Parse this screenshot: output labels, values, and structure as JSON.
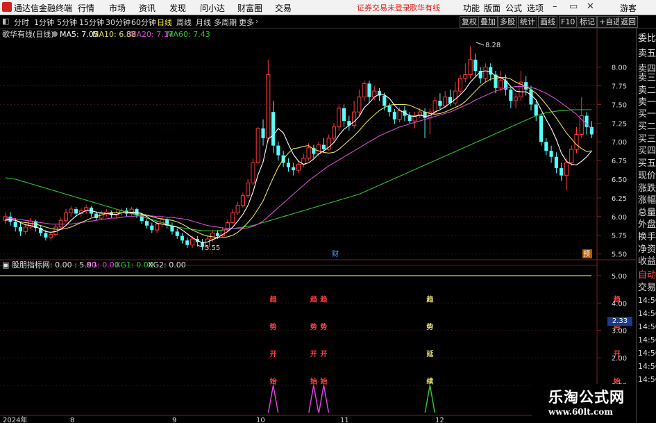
{
  "app": {
    "name": "通达信金融终端"
  },
  "menu": [
    "行情",
    "市场",
    "资讯",
    "发现",
    "问小达",
    "财富圈",
    "交易"
  ],
  "notice": {
    "text1": "证券交易未登录",
    "text2": "歌华有线"
  },
  "top_controls": [
    "功能",
    "版面",
    "公式",
    "选项"
  ],
  "user": "游客",
  "periods": [
    "分时",
    "1分钟",
    "5分钟",
    "15分钟",
    "30分钟",
    "60分钟",
    "日线",
    "周线",
    "月线",
    "多周期",
    "更多"
  ],
  "active_period": "日线",
  "tool_buttons": [
    "复权",
    "叠加",
    "多股",
    "统计",
    "画线",
    "F10",
    "标记",
    "+自选",
    "返回"
  ],
  "main_chart": {
    "stock_title": "歌华有线(日线)",
    "ma": [
      {
        "label": "MA5: 7.05",
        "color": "#ffffff"
      },
      {
        "label": "MA10: 6.88",
        "color": "#e8e060"
      },
      {
        "label": "MA20: 7.17",
        "color": "#d24fd2"
      },
      {
        "label": "MA60: 7.43",
        "color": "#2ec72e"
      }
    ],
    "price_axis": [
      "8.00",
      "7.75",
      "7.50",
      "7.25",
      "7.00",
      "6.75",
      "6.50",
      "6.25",
      "6.00",
      "5.75",
      "5.50"
    ],
    "high_mark": "8.28",
    "low_mark": "5.55",
    "event_marks": [
      "财",
      "预"
    ]
  },
  "indicator": {
    "title": "股朋指标网",
    "values_text": ": 0.00 : 5.00",
    "xg": "XG: 0.00",
    "xg1": "XG1: 0.00",
    "xg2": "XG2: 0.00",
    "axis": [
      "5.00",
      "4.00",
      "3.00",
      "2.00",
      "1.00"
    ],
    "signals": [
      {
        "chars": [
          "趋",
          "势",
          "开",
          "始"
        ],
        "color": "#ff4040"
      },
      {
        "chars": [
          "趋",
          "势",
          "开",
          "始"
        ],
        "color": "#ff4040"
      },
      {
        "chars": [
          "趋",
          "势",
          "开",
          "始"
        ],
        "color": "#ff4040"
      },
      {
        "chars": [
          "趋",
          "势",
          "延",
          "续"
        ],
        "color": "#e8e070"
      },
      {
        "chars": [
          "趋",
          "势",
          "开",
          "始"
        ],
        "color": "#ff4040"
      }
    ]
  },
  "date_axis": [
    "2024年",
    "8",
    "9",
    "10",
    "11",
    "12"
  ],
  "right_panel": {
    "labels": [
      "委比",
      "卖五",
      "卖四",
      "卖三",
      "卖二",
      "卖一",
      "买一",
      "买二",
      "买三",
      "买四",
      "买五",
      "现价",
      "涨跌",
      "涨幅",
      "总量",
      "外盘",
      "换手",
      "净资",
      "收益",
      "自动",
      "交易"
    ],
    "value": "2.33",
    "times": [
      "14:56",
      "14:56",
      "14:56",
      "14:56",
      "14:56",
      "14:56",
      "14:56"
    ]
  },
  "watermark": {
    "title": "乐淘公式网",
    "url": "www.60lt.com"
  },
  "chart_data": {
    "type": "candlestick",
    "series": [
      {
        "name": "MA5: 7.05",
        "color": "#ffffff"
      },
      {
        "name": "MA10: 6.88",
        "color": "#e8e060"
      },
      {
        "name": "MA20: 7.17",
        "color": "#d24fd2"
      },
      {
        "name": "MA60: 7.43",
        "color": "#2ec72e"
      }
    ],
    "candles": [
      [
        5.95,
        6.0,
        6.05,
        5.9
      ],
      [
        6.0,
        5.93,
        6.06,
        5.88
      ],
      [
        5.93,
        5.86,
        5.98,
        5.8
      ],
      [
        5.86,
        5.8,
        5.92,
        5.74
      ],
      [
        5.8,
        5.86,
        5.9,
        5.76
      ],
      [
        5.86,
        5.94,
        5.98,
        5.83
      ],
      [
        5.94,
        5.85,
        5.96,
        5.8
      ],
      [
        5.85,
        5.78,
        5.88,
        5.74
      ],
      [
        5.78,
        5.72,
        5.82,
        5.68
      ],
      [
        5.72,
        5.76,
        5.8,
        5.68
      ],
      [
        5.76,
        5.86,
        5.9,
        5.74
      ],
      [
        5.86,
        5.95,
        5.99,
        5.84
      ],
      [
        5.95,
        6.05,
        6.1,
        5.92
      ],
      [
        6.05,
        6.1,
        6.14,
        6.0
      ],
      [
        6.1,
        6.04,
        6.13,
        6.0
      ],
      [
        6.04,
        6.08,
        6.11,
        6.0
      ],
      [
        6.08,
        6.12,
        6.16,
        6.04
      ],
      [
        6.12,
        6.04,
        6.14,
        6.0
      ],
      [
        6.04,
        5.98,
        6.07,
        5.95
      ],
      [
        5.98,
        6.04,
        6.08,
        5.95
      ],
      [
        6.04,
        6.06,
        6.1,
        6.0
      ],
      [
        6.06,
        6.02,
        6.08,
        5.98
      ],
      [
        6.02,
        6.05,
        6.09,
        5.98
      ],
      [
        6.05,
        6.08,
        6.11,
        6.01
      ],
      [
        6.08,
        6.04,
        6.12,
        6.0
      ],
      [
        6.04,
        6.1,
        6.13,
        6.01
      ],
      [
        6.1,
        6.02,
        6.12,
        5.98
      ],
      [
        6.02,
        5.94,
        6.05,
        5.9
      ],
      [
        5.94,
        5.88,
        5.97,
        5.84
      ],
      [
        5.88,
        5.82,
        5.92,
        5.78
      ],
      [
        5.82,
        5.9,
        5.94,
        5.78
      ],
      [
        5.9,
        5.96,
        6.0,
        5.86
      ],
      [
        5.96,
        5.88,
        5.98,
        5.84
      ],
      [
        5.88,
        5.8,
        5.92,
        5.76
      ],
      [
        5.8,
        5.74,
        5.84,
        5.7
      ],
      [
        5.74,
        5.68,
        5.78,
        5.64
      ],
      [
        5.68,
        5.62,
        5.72,
        5.58
      ],
      [
        5.62,
        5.7,
        5.74,
        5.58
      ],
      [
        5.7,
        5.66,
        5.74,
        5.6
      ],
      [
        5.66,
        5.6,
        5.7,
        5.55
      ],
      [
        5.6,
        5.7,
        5.74,
        5.58
      ],
      [
        5.7,
        5.78,
        5.82,
        5.66
      ],
      [
        5.78,
        5.74,
        5.82,
        5.7
      ],
      [
        5.74,
        5.82,
        5.86,
        5.72
      ],
      [
        5.82,
        5.92,
        5.96,
        5.8
      ],
      [
        5.92,
        6.05,
        6.1,
        5.9
      ],
      [
        6.05,
        6.15,
        6.2,
        6.02
      ],
      [
        6.15,
        6.28,
        6.32,
        6.12
      ],
      [
        6.28,
        6.45,
        6.5,
        6.25
      ],
      [
        6.45,
        6.72,
        6.78,
        6.42
      ],
      [
        6.72,
        7.18,
        7.2,
        6.7
      ],
      [
        7.18,
        7.05,
        7.3,
        6.95
      ],
      [
        7.05,
        7.9,
        8.1,
        7.0
      ],
      [
        7.4,
        6.95,
        7.55,
        6.85
      ],
      [
        6.95,
        6.82,
        7.0,
        6.75
      ],
      [
        6.82,
        6.72,
        6.88,
        6.66
      ],
      [
        6.72,
        6.66,
        6.78,
        6.6
      ],
      [
        6.66,
        6.62,
        6.72,
        6.55
      ],
      [
        6.62,
        6.7,
        6.75,
        6.58
      ],
      [
        6.7,
        6.78,
        6.84,
        6.66
      ],
      [
        6.78,
        6.92,
        6.98,
        6.75
      ],
      [
        6.92,
        6.84,
        6.96,
        6.78
      ],
      [
        6.84,
        6.96,
        7.0,
        6.8
      ],
      [
        6.96,
        6.9,
        7.05,
        6.85
      ],
      [
        6.9,
        7.05,
        7.1,
        6.88
      ],
      [
        7.05,
        7.2,
        7.25,
        7.0
      ],
      [
        7.2,
        7.45,
        7.5,
        7.15
      ],
      [
        7.45,
        7.28,
        7.5,
        7.2
      ],
      [
        7.28,
        7.22,
        7.35,
        7.15
      ],
      [
        7.22,
        7.4,
        7.55,
        7.18
      ],
      [
        7.4,
        7.6,
        7.7,
        7.36
      ],
      [
        7.6,
        7.78,
        7.82,
        7.55
      ],
      [
        7.78,
        7.6,
        7.82,
        7.52
      ],
      [
        7.6,
        7.68,
        7.75,
        7.56
      ],
      [
        7.68,
        7.62,
        7.72,
        7.55
      ],
      [
        7.62,
        7.48,
        7.66,
        7.42
      ],
      [
        7.48,
        7.4,
        7.52,
        7.34
      ],
      [
        7.4,
        7.3,
        7.44,
        7.24
      ],
      [
        7.3,
        7.42,
        7.46,
        7.26
      ],
      [
        7.42,
        7.35,
        7.48,
        7.28
      ],
      [
        7.35,
        7.28,
        7.4,
        7.24
      ],
      [
        7.28,
        7.35,
        7.4,
        7.18
      ],
      [
        7.35,
        7.4,
        7.45,
        7.32
      ],
      [
        7.4,
        7.32,
        7.45,
        7.05
      ],
      [
        7.32,
        7.4,
        7.45,
        7.1
      ],
      [
        7.4,
        7.55,
        7.6,
        7.36
      ],
      [
        7.55,
        7.48,
        7.65,
        7.44
      ],
      [
        7.48,
        7.6,
        7.68,
        7.45
      ],
      [
        7.6,
        7.52,
        7.7,
        7.48
      ],
      [
        7.52,
        7.68,
        7.8,
        7.48
      ],
      [
        7.68,
        7.85,
        7.9,
        7.64
      ],
      [
        7.85,
        7.9,
        8.05,
        7.8
      ],
      [
        7.9,
        8.1,
        8.28,
        7.85
      ],
      [
        8.1,
        7.95,
        8.18,
        7.88
      ],
      [
        7.95,
        7.85,
        8.0,
        7.78
      ],
      [
        7.85,
        8.0,
        8.05,
        7.8
      ],
      [
        8.0,
        7.9,
        8.05,
        7.82
      ],
      [
        7.9,
        7.72,
        7.95,
        7.65
      ],
      [
        7.72,
        7.82,
        7.95,
        7.68
      ],
      [
        7.82,
        7.7,
        7.9,
        7.62
      ],
      [
        7.7,
        7.55,
        7.75,
        7.45
      ],
      [
        7.55,
        7.6,
        7.65,
        7.45
      ],
      [
        7.6,
        7.8,
        7.95,
        7.55
      ],
      [
        7.8,
        7.7,
        7.88,
        7.62
      ],
      [
        7.7,
        7.5,
        7.75,
        7.42
      ],
      [
        7.5,
        7.35,
        7.55,
        7.28
      ],
      [
        7.35,
        7.0,
        7.38,
        6.95
      ],
      [
        7.0,
        6.88,
        7.05,
        6.82
      ],
      [
        6.88,
        6.8,
        6.95,
        6.72
      ],
      [
        6.8,
        6.65,
        6.86,
        6.58
      ],
      [
        6.65,
        6.55,
        6.72,
        6.48
      ],
      [
        6.55,
        6.72,
        6.78,
        6.35
      ],
      [
        6.72,
        6.9,
        6.95,
        6.68
      ],
      [
        6.9,
        7.1,
        7.2,
        6.85
      ],
      [
        7.1,
        7.35,
        7.6,
        7.05
      ],
      [
        7.35,
        7.2,
        7.4,
        7.1
      ],
      [
        7.2,
        7.1,
        7.28,
        7.05
      ]
    ],
    "ma5": [
      5.95,
      5.96,
      5.95,
      5.92,
      5.89,
      5.88,
      5.86,
      5.84,
      5.8,
      5.79,
      5.8,
      5.83,
      5.88,
      5.95,
      6.01,
      6.05,
      6.08,
      6.08,
      6.06,
      6.05,
      6.04,
      6.03,
      6.03,
      6.05,
      6.05,
      6.06,
      6.06,
      6.04,
      6.0,
      5.95,
      5.91,
      5.9,
      5.89,
      5.87,
      5.86,
      5.82,
      5.77,
      5.72,
      5.68,
      5.65,
      5.66,
      5.69,
      5.72,
      5.76,
      5.8,
      5.86,
      5.94,
      6.03,
      6.15,
      6.33,
      6.56,
      6.73,
      7.04,
      7.09,
      7.18,
      7.12,
      6.97,
      6.83,
      6.74,
      6.7,
      6.72,
      6.77,
      6.84,
      6.88,
      6.93,
      6.99,
      7.09,
      7.17,
      7.22,
      7.27,
      7.34,
      7.46,
      7.52,
      7.6,
      7.64,
      7.63,
      7.58,
      7.49,
      7.42,
      7.39,
      7.35,
      7.34,
      7.36,
      7.34,
      7.35,
      7.4,
      7.43,
      7.47,
      7.52,
      7.57,
      7.63,
      7.7,
      7.8,
      7.87,
      7.94,
      7.95,
      7.94,
      7.88,
      7.86,
      7.82,
      7.74,
      7.68,
      7.67,
      7.67,
      7.63,
      7.56,
      7.43,
      7.3,
      7.18,
      7.03,
      6.85,
      6.74,
      6.7,
      6.69,
      6.74,
      6.8,
      6.88
    ],
    "ma10": [
      5.96,
      5.96,
      5.95,
      5.93,
      5.92,
      5.91,
      5.9,
      5.88,
      5.86,
      5.84,
      5.83,
      5.83,
      5.84,
      5.86,
      5.89,
      5.92,
      5.95,
      5.98,
      6.0,
      6.02,
      6.04,
      6.05,
      6.05,
      6.05,
      6.05,
      6.05,
      6.04,
      6.03,
      6.02,
      6.0,
      5.98,
      5.97,
      5.96,
      5.95,
      5.93,
      5.9,
      5.86,
      5.82,
      5.79,
      5.76,
      5.74,
      5.73,
      5.72,
      5.72,
      5.73,
      5.75,
      5.79,
      5.85,
      5.92,
      6.0,
      6.1,
      6.21,
      6.37,
      6.52,
      6.66,
      6.77,
      6.85,
      6.91,
      6.92,
      6.94,
      6.95,
      6.9,
      6.88,
      6.86,
      6.85,
      6.86,
      6.9,
      6.96,
      7.02,
      7.08,
      7.15,
      7.23,
      7.3,
      7.36,
      7.42,
      7.46,
      7.49,
      7.5,
      7.5,
      7.5,
      7.49,
      7.46,
      7.43,
      7.4,
      7.38,
      7.37,
      7.38,
      7.4,
      7.43,
      7.46,
      7.49,
      7.54,
      7.61,
      7.68,
      7.75,
      7.8,
      7.84,
      7.85,
      7.86,
      7.86,
      7.84,
      7.8,
      7.77,
      7.74,
      7.7,
      7.65,
      7.58,
      7.5,
      7.41,
      7.32,
      7.22,
      7.12,
      7.04,
      6.96,
      6.91,
      6.87,
      6.88
    ],
    "ma20": [
      5.98,
      5.98,
      5.97,
      5.96,
      5.95,
      5.94,
      5.93,
      5.92,
      5.91,
      5.9,
      5.9,
      5.9,
      5.9,
      5.9,
      5.91,
      5.92,
      5.93,
      5.94,
      5.95,
      5.96,
      5.97,
      5.98,
      5.98,
      5.99,
      6.0,
      6.0,
      6.01,
      6.01,
      6.01,
      6.01,
      6.0,
      6.0,
      5.99,
      5.99,
      5.98,
      5.97,
      5.96,
      5.94,
      5.92,
      5.9,
      5.88,
      5.87,
      5.86,
      5.85,
      5.84,
      5.84,
      5.84,
      5.84,
      5.85,
      5.87,
      5.9,
      5.94,
      6.0,
      6.06,
      6.12,
      6.18,
      6.24,
      6.3,
      6.36,
      6.42,
      6.48,
      6.53,
      6.58,
      6.63,
      6.68,
      6.72,
      6.76,
      6.8,
      6.84,
      6.88,
      6.92,
      6.96,
      7.0,
      7.04,
      7.08,
      7.11,
      7.14,
      7.17,
      7.2,
      7.22,
      7.24,
      7.26,
      7.28,
      7.3,
      7.32,
      7.34,
      7.36,
      7.38,
      7.4,
      7.43,
      7.46,
      7.49,
      7.52,
      7.56,
      7.59,
      7.62,
      7.65,
      7.68,
      7.7,
      7.72,
      7.73,
      7.74,
      7.74,
      7.74,
      7.73,
      7.71,
      7.68,
      7.65,
      7.61,
      7.57,
      7.52,
      7.47,
      7.42,
      7.37,
      7.3,
      7.24,
      7.17
    ],
    "ma60": [
      6.52,
      6.51,
      6.5,
      6.48,
      6.46,
      6.44,
      6.42,
      6.4,
      6.38,
      6.36,
      6.34,
      6.32,
      6.3,
      6.28,
      6.26,
      6.24,
      6.22,
      6.2,
      6.18,
      6.16,
      6.14,
      6.12,
      6.1,
      6.08,
      6.06,
      6.04,
      6.02,
      6.0,
      5.98,
      5.96,
      5.94,
      5.92,
      5.9,
      5.88,
      5.86,
      5.85,
      5.84,
      5.83,
      5.82,
      5.81,
      5.81,
      5.81,
      5.81,
      5.82,
      5.83,
      5.84,
      5.85,
      5.86,
      5.87,
      5.88,
      5.9,
      5.92,
      5.94,
      5.96,
      5.98,
      6.0,
      6.02,
      6.04,
      6.06,
      6.08,
      6.1,
      6.12,
      6.14,
      6.16,
      6.18,
      6.2,
      6.22,
      6.24,
      6.26,
      6.28,
      6.3,
      6.33,
      6.36,
      6.39,
      6.42,
      6.45,
      6.48,
      6.51,
      6.54,
      6.57,
      6.6,
      6.63,
      6.66,
      6.69,
      6.72,
      6.75,
      6.78,
      6.81,
      6.84,
      6.87,
      6.9,
      6.93,
      6.96,
      6.99,
      7.02,
      7.05,
      7.08,
      7.11,
      7.14,
      7.17,
      7.2,
      7.23,
      7.26,
      7.29,
      7.32,
      7.35,
      7.37,
      7.39,
      7.4,
      7.41,
      7.42,
      7.42,
      7.43,
      7.43,
      7.43,
      7.43,
      7.43
    ],
    "signal_bars": [
      {
        "index": 53,
        "value": 1,
        "color": "#e040e0"
      },
      {
        "index": 61,
        "value": 1,
        "color": "#e040e0"
      },
      {
        "index": 63,
        "value": 1,
        "color": "#e040e0"
      },
      {
        "index": 84,
        "value": 1,
        "color": "#2ec72e"
      },
      {
        "index": 121,
        "value": 1,
        "color": "#e040e0"
      }
    ],
    "ylim": [
      5.45,
      8.35
    ],
    "indicator_ylim": [
      0,
      5.2
    ]
  }
}
